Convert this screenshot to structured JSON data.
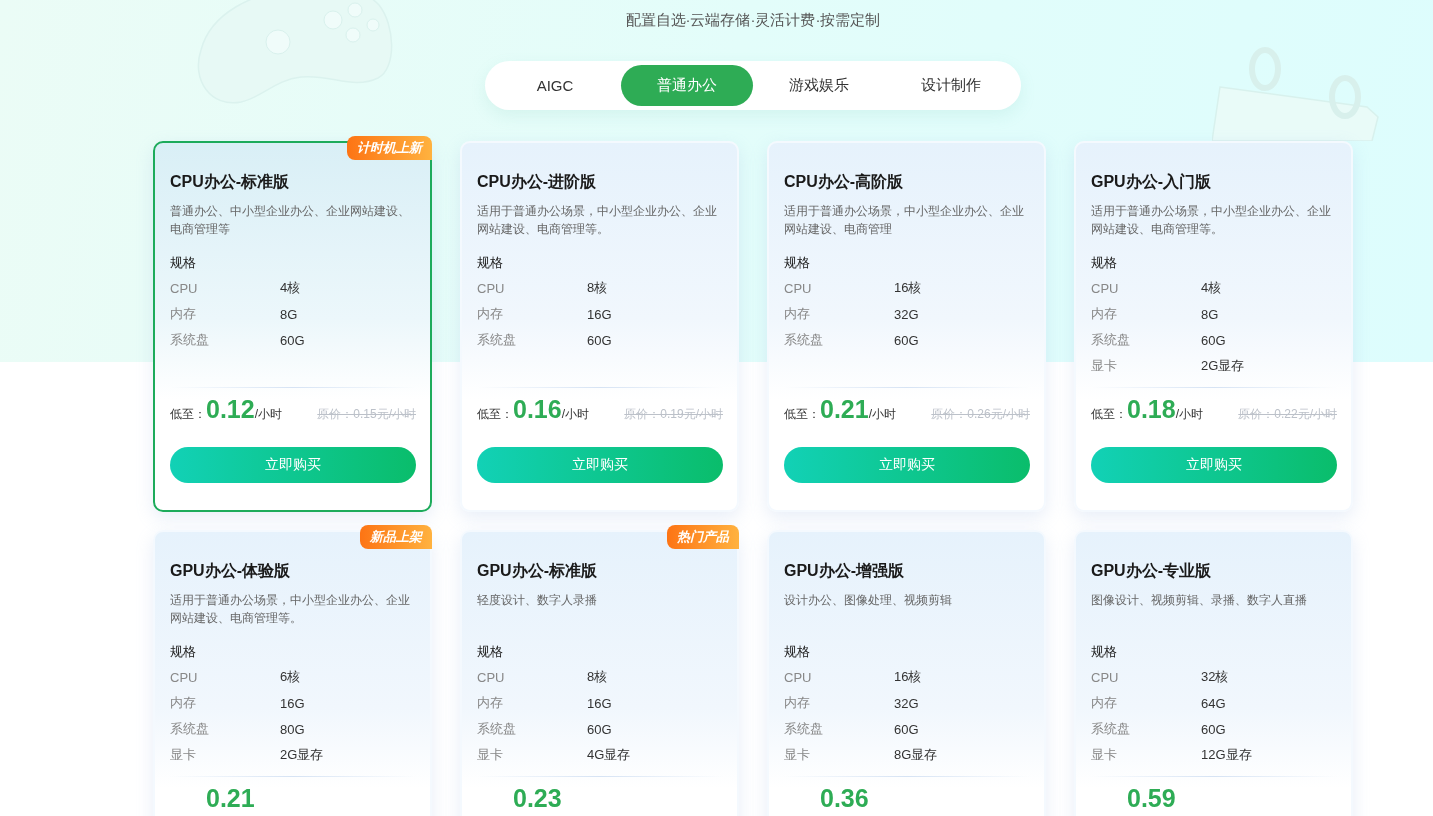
{
  "header": {
    "subtitle": "配置自选·云端存储·灵活计费·按需定制"
  },
  "tabs": [
    {
      "label": "AIGC",
      "selected": false
    },
    {
      "label": "普通办公",
      "selected": true
    },
    {
      "label": "游戏娱乐",
      "selected": false
    },
    {
      "label": "设计制作",
      "selected": false
    }
  ],
  "plans": [
    {
      "name": "CPU办公-标准版",
      "badge": "计时机上新",
      "selected": true,
      "description": "普通办公、中小型企业办公、企业网站建设、电商管理等",
      "spec_heading": "规格",
      "specs": [
        {
          "label": "CPU",
          "value": "4核"
        },
        {
          "label": "内存",
          "value": "8G"
        },
        {
          "label": "系统盘",
          "value": "60G"
        }
      ],
      "price_prefix": "低至：",
      "price": "0.12",
      "price_unit": "/小时",
      "original_price": "原价：0.15元/小时",
      "button": "立即购买"
    },
    {
      "name": "CPU办公-进阶版",
      "selected": false,
      "description": "适用于普通办公场景，中小型企业办公、企业网站建设、电商管理等。",
      "spec_heading": "规格",
      "specs": [
        {
          "label": "CPU",
          "value": "8核"
        },
        {
          "label": "内存",
          "value": "16G"
        },
        {
          "label": "系统盘",
          "value": "60G"
        }
      ],
      "price_prefix": "低至：",
      "price": "0.16",
      "price_unit": "/小时",
      "original_price": "原价：0.19元/小时",
      "button": "立即购买"
    },
    {
      "name": "CPU办公-高阶版",
      "selected": false,
      "description": "适用于普通办公场景，中小型企业办公、企业网站建设、电商管理",
      "spec_heading": "规格",
      "specs": [
        {
          "label": "CPU",
          "value": "16核"
        },
        {
          "label": "内存",
          "value": "32G"
        },
        {
          "label": "系统盘",
          "value": "60G"
        }
      ],
      "price_prefix": "低至：",
      "price": "0.21",
      "price_unit": "/小时",
      "original_price": "原价：0.26元/小时",
      "button": "立即购买"
    },
    {
      "name": "GPU办公-入门版",
      "selected": false,
      "description": "适用于普通办公场景，中小型企业办公、企业网站建设、电商管理等。",
      "spec_heading": "规格",
      "specs": [
        {
          "label": "CPU",
          "value": "4核"
        },
        {
          "label": "内存",
          "value": "8G"
        },
        {
          "label": "系统盘",
          "value": "60G"
        },
        {
          "label": "显卡",
          "value": "2G显存"
        }
      ],
      "price_prefix": "低至：",
      "price": "0.18",
      "price_unit": "/小时",
      "original_price": "原价：0.22元/小时",
      "button": "立即购买"
    },
    {
      "name": "GPU办公-体验版",
      "badge": "新品上架",
      "selected": false,
      "description": "适用于普通办公场景，中小型企业办公、企业网站建设、电商管理等。",
      "spec_heading": "规格",
      "specs": [
        {
          "label": "CPU",
          "value": "6核"
        },
        {
          "label": "内存",
          "value": "16G"
        },
        {
          "label": "系统盘",
          "value": "80G"
        },
        {
          "label": "显卡",
          "value": "2G显存"
        }
      ],
      "price": "0.21"
    },
    {
      "name": "GPU办公-标准版",
      "badge": "热门产品",
      "selected": false,
      "description": "轻度设计、数字人录播",
      "spec_heading": "规格",
      "specs": [
        {
          "label": "CPU",
          "value": "8核"
        },
        {
          "label": "内存",
          "value": "16G"
        },
        {
          "label": "系统盘",
          "value": "60G"
        },
        {
          "label": "显卡",
          "value": "4G显存"
        }
      ],
      "price": "0.23"
    },
    {
      "name": "GPU办公-增强版",
      "selected": false,
      "description": "设计办公、图像处理、视频剪辑",
      "spec_heading": "规格",
      "specs": [
        {
          "label": "CPU",
          "value": "16核"
        },
        {
          "label": "内存",
          "value": "32G"
        },
        {
          "label": "系统盘",
          "value": "60G"
        },
        {
          "label": "显卡",
          "value": "8G显存"
        }
      ],
      "price": "0.36"
    },
    {
      "name": "GPU办公-专业版",
      "selected": false,
      "description": "图像设计、视频剪辑、录播、数字人直播",
      "spec_heading": "规格",
      "specs": [
        {
          "label": "CPU",
          "value": "32核"
        },
        {
          "label": "内存",
          "value": "64G"
        },
        {
          "label": "系统盘",
          "value": "60G"
        },
        {
          "label": "显卡",
          "value": "12G显存"
        }
      ],
      "price": "0.59"
    }
  ]
}
